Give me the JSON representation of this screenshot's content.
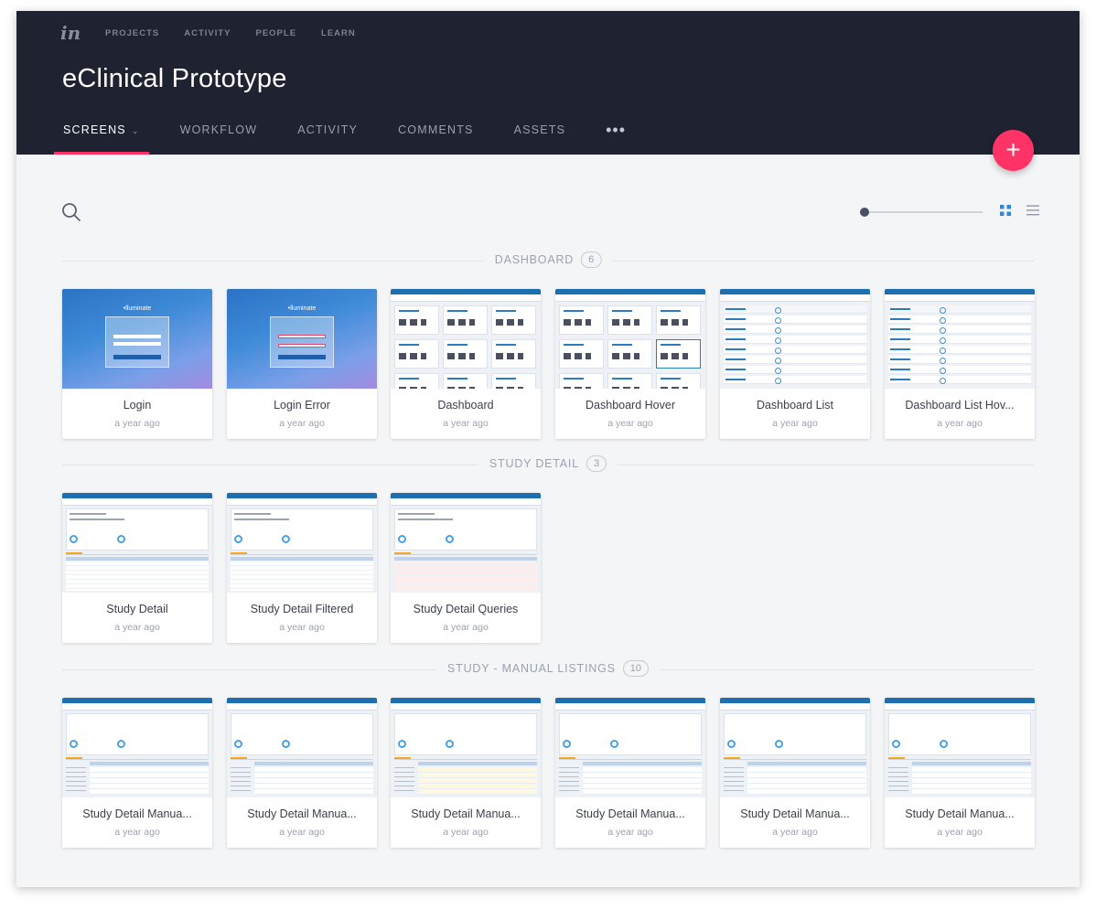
{
  "app": {
    "logo": "in"
  },
  "topnav": [
    "PROJECTS",
    "ACTIVITY",
    "PEOPLE",
    "LEARN"
  ],
  "project": {
    "title": "eClinical Prototype"
  },
  "tabs": [
    {
      "label": "SCREENS",
      "active": true
    },
    {
      "label": "WORKFLOW",
      "active": false
    },
    {
      "label": "ACTIVITY",
      "active": false
    },
    {
      "label": "COMMENTS",
      "active": false
    },
    {
      "label": "ASSETS",
      "active": false
    },
    {
      "label": "•••",
      "active": false
    }
  ],
  "fab": {
    "label": "+"
  },
  "toolbar": {
    "zoom_level": 0,
    "view": "grid"
  },
  "colors": {
    "accent": "#ff3366",
    "header_bg": "#1f2230",
    "page_bg": "#f4f5f7"
  },
  "sections": [
    {
      "name": "DASHBOARD",
      "count": "6",
      "screens": [
        {
          "title": "Login",
          "date": "a year ago"
        },
        {
          "title": "Login Error",
          "date": "a year ago"
        },
        {
          "title": "Dashboard",
          "date": "a year ago"
        },
        {
          "title": "Dashboard Hover",
          "date": "a year ago"
        },
        {
          "title": "Dashboard List",
          "date": "a year ago"
        },
        {
          "title": "Dashboard List Hov...",
          "date": "a year ago"
        }
      ]
    },
    {
      "name": "STUDY DETAIL",
      "count": "3",
      "screens": [
        {
          "title": "Study Detail",
          "date": "a year ago"
        },
        {
          "title": "Study Detail Filtered",
          "date": "a year ago"
        },
        {
          "title": "Study Detail Queries",
          "date": "a year ago"
        }
      ]
    },
    {
      "name": "STUDY - MANUAL LISTINGS",
      "count": "10",
      "screens": [
        {
          "title": "Study Detail Manua...",
          "date": "a year ago"
        },
        {
          "title": "Study Detail Manua...",
          "date": "a year ago"
        },
        {
          "title": "Study Detail Manua...",
          "date": "a year ago"
        },
        {
          "title": "Study Detail Manua...",
          "date": "a year ago"
        },
        {
          "title": "Study Detail Manua...",
          "date": "a year ago"
        },
        {
          "title": "Study Detail Manua...",
          "date": "a year ago"
        }
      ]
    }
  ]
}
